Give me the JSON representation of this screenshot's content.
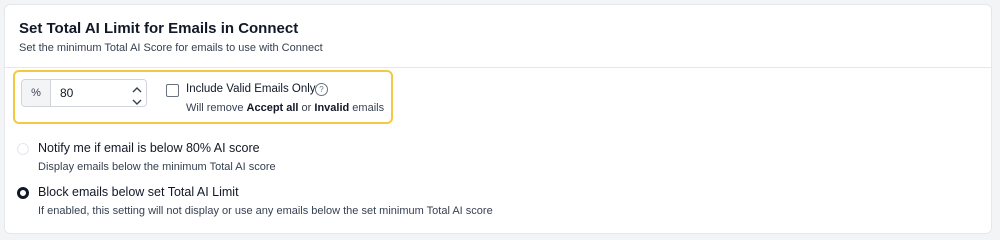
{
  "section": {
    "title": "Set Total AI Limit for Emails in Connect",
    "subtitle": "Set the minimum Total AI Score for emails to use with Connect"
  },
  "limit_input": {
    "unit": "%",
    "value": "80"
  },
  "valid_only": {
    "label": "Include Valid Emails Only",
    "checked": false,
    "desc_prefix": "Will remove ",
    "desc_bold1": "Accept all",
    "desc_middle": " or ",
    "desc_bold2": "Invalid",
    "desc_suffix": " emails"
  },
  "options": {
    "notify": {
      "label": "Notify me if email is below 80% AI score",
      "desc": "Display emails below the minimum Total AI score",
      "selected": false
    },
    "block": {
      "label": "Block emails below set Total AI Limit",
      "desc": "If enabled, this setting will not display or use any emails below the set minimum Total AI score",
      "selected": true
    }
  },
  "colors": {
    "highlight": "#f5c842",
    "text": "#111827"
  },
  "icons": {
    "help": "help-circle-icon",
    "up": "chevron-up-icon",
    "down": "chevron-down-icon"
  }
}
